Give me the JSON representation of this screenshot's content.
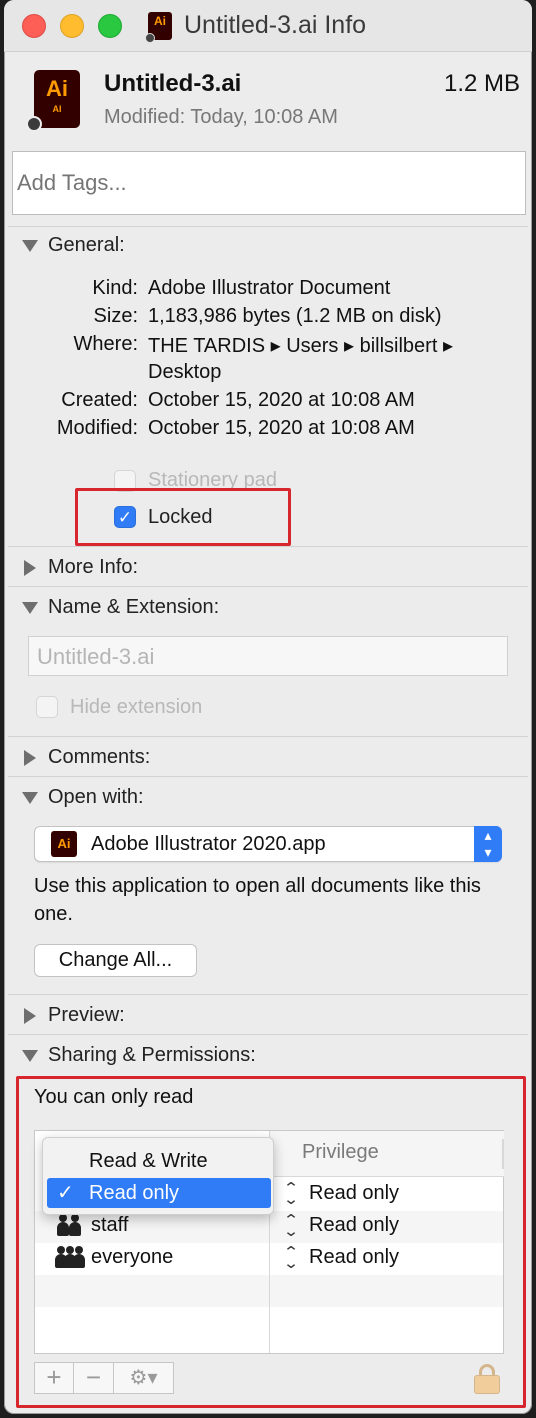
{
  "window": {
    "title": "Untitled-3.ai Info",
    "title_icon_label": "Ai"
  },
  "header": {
    "icon_label_big": "Ai",
    "icon_label_small": "AI",
    "filename": "Untitled-3.ai",
    "filesize": "1.2 MB",
    "modified": "Modified: Today, 10:08 AM"
  },
  "tags": {
    "placeholder": "Add Tags..."
  },
  "general": {
    "heading": "General:",
    "rows": [
      {
        "label": "Kind:",
        "value": "Adobe Illustrator Document"
      },
      {
        "label": "Size:",
        "value": "1,183,986 bytes (1.2 MB on disk)"
      },
      {
        "label": "Where:",
        "value": "THE TARDIS ▸ Users ▸ billsilbert ▸"
      },
      {
        "label": "",
        "value": "Desktop"
      },
      {
        "label": "Created:",
        "value": "October 15, 2020 at 10:08 AM"
      },
      {
        "label": "Modified:",
        "value": "October 15, 2020 at 10:08 AM"
      }
    ],
    "stationery_label": "Stationery pad",
    "stationery_checked": false,
    "locked_label": "Locked",
    "locked_checked": true
  },
  "more_info": {
    "heading": "More Info:"
  },
  "name_extension": {
    "heading": "Name & Extension:",
    "name_value": "Untitled-3.ai",
    "hide_extension_label": "Hide extension"
  },
  "comments": {
    "heading": "Comments:"
  },
  "open_with": {
    "heading": "Open with:",
    "app_icon_label": "Ai",
    "selected_app": "Adobe Illustrator 2020.app",
    "description": "Use this application to open all documents like this one.",
    "change_all_label": "Change All..."
  },
  "preview": {
    "heading": "Preview:"
  },
  "sharing": {
    "heading": "Sharing & Permissions:",
    "status": "You can only read",
    "privilege_header": "Privilege",
    "rows": [
      {
        "name": "",
        "privilege": "Read only"
      },
      {
        "name": "staff",
        "privilege": "Read only"
      },
      {
        "name": "everyone",
        "privilege": "Read only"
      }
    ],
    "menu": {
      "options": [
        "Read & Write",
        "Read only"
      ],
      "selected": "Read only"
    },
    "add_label": "+",
    "remove_label": "−",
    "gear_label": "⚙▾"
  },
  "colors": {
    "accent": "#2f7cf6",
    "highlight_box": "#d8262e",
    "illustrator_bg": "#330000",
    "illustrator_fg": "#ff9a00"
  }
}
